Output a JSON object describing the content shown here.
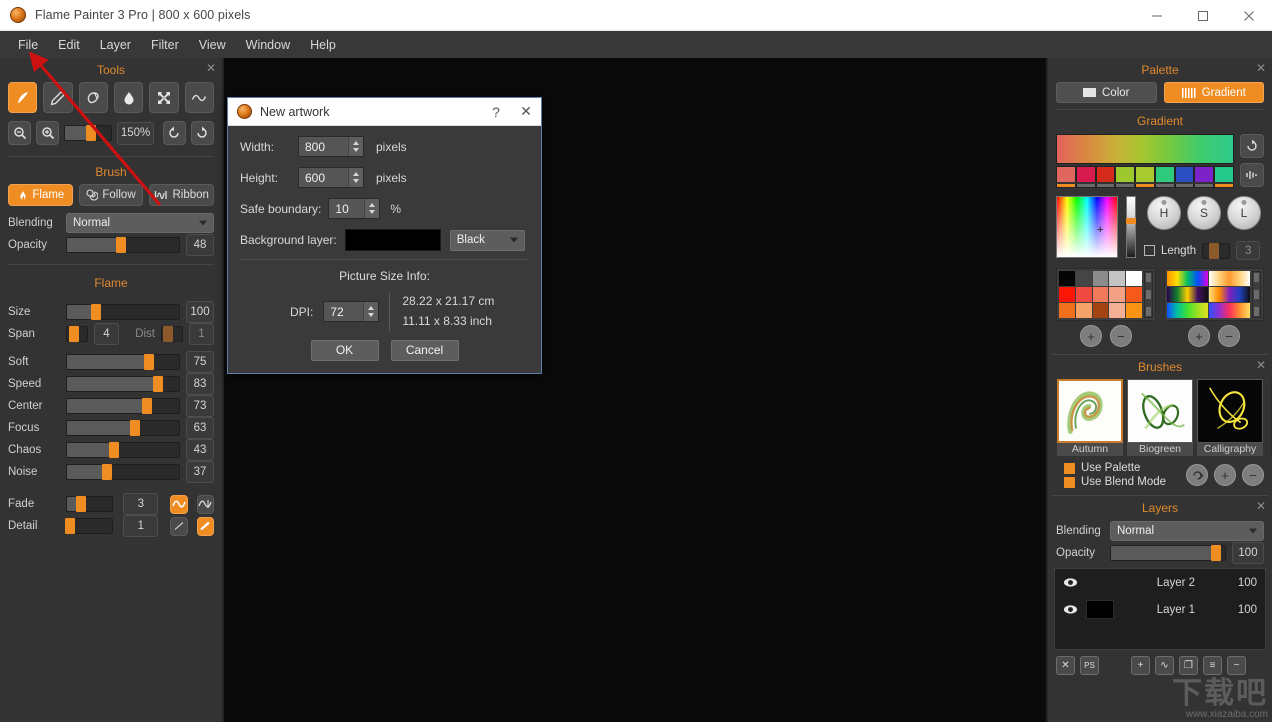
{
  "window": {
    "title": "Flame Painter 3 Pro | 800 x 600 pixels",
    "minimize": "—",
    "maximize": "□",
    "close": "✕"
  },
  "menubar": {
    "items": [
      "File",
      "Edit",
      "Layer",
      "Filter",
      "View",
      "Window",
      "Help"
    ]
  },
  "tools_panel": {
    "title": "Tools",
    "close": "✕",
    "tools": [
      {
        "name": "flame-brush-tool",
        "icon": "feather-icon",
        "active": true
      },
      {
        "name": "pencil-tool",
        "icon": "pencil-icon",
        "active": false
      },
      {
        "name": "eraser-tool",
        "icon": "eraser-icon",
        "active": false
      },
      {
        "name": "smudge-tool",
        "icon": "droplet-icon",
        "active": false
      },
      {
        "name": "transform-tool",
        "icon": "move-arrows-icon",
        "active": false
      },
      {
        "name": "curve-tool",
        "icon": "wave-icon",
        "active": false
      }
    ],
    "zoom_out": "zoom-out-icon",
    "zoom_in": "zoom-in-icon",
    "zoom_value": "150%",
    "zoom_slider_percent": 57,
    "rotate_left": "rotate-ccw-icon",
    "rotate_right": "rotate-cw-icon"
  },
  "brush_panel": {
    "title": "Brush",
    "modes": [
      {
        "label": "Flame",
        "icon": "flame-icon",
        "active": true
      },
      {
        "label": "Follow",
        "icon": "spiral-icon",
        "active": false
      },
      {
        "label": "Ribbon",
        "icon": "ribbon-icon",
        "active": false
      }
    ],
    "blending_label": "Blending",
    "blending_value": "Normal",
    "opacity_label": "Opacity",
    "opacity_value": "48",
    "opacity_percent": 48
  },
  "flame_panel": {
    "title": "Flame",
    "size_label": "Size",
    "size_value": "100",
    "size_percent": 26,
    "span_label": "Span",
    "span_value": "4",
    "span_percent": 35,
    "dist_label": "Dist",
    "dist_value": "1",
    "dist_percent": 30,
    "sliders": [
      {
        "label": "Soft",
        "value": "75",
        "percent": 73
      },
      {
        "label": "Speed",
        "value": "83",
        "percent": 81
      },
      {
        "label": "Center",
        "value": "73",
        "percent": 71
      },
      {
        "label": "Focus",
        "value": "63",
        "percent": 61
      },
      {
        "label": "Chaos",
        "value": "43",
        "percent": 42
      },
      {
        "label": "Noise",
        "value": "37",
        "percent": 36
      }
    ],
    "fade_label": "Fade",
    "fade_value": "3",
    "fade_percent": 30,
    "detail_label": "Detail",
    "detail_value": "1",
    "detail_percent": 6,
    "toggle_a": "wave-filled-icon",
    "toggle_b": "wave-outline-icon",
    "toggle_c": "line-thin-icon",
    "toggle_d": "line-thick-icon"
  },
  "palette_panel": {
    "title": "Palette",
    "close": "✕",
    "mode_color": "Color",
    "mode_gradient": "Gradient",
    "active_mode": "Gradient",
    "gradient_title": "Gradient",
    "gradient_stops": [
      "#e2635e",
      "#d98a3e",
      "#c9b03a",
      "#a8c62f",
      "#74c93e",
      "#3ecb6e",
      "#2ecb8c"
    ],
    "swatch_row": [
      "#e0675f",
      "#d81b4e",
      "#d42b1d",
      "#9dc82e",
      "#a8c92f",
      "#2ec97c",
      "#2c4fc4",
      "#7b23c9",
      "#24c88a"
    ],
    "swatch_underline": [
      "#ef8c22",
      "#6a6a6a",
      "#6a6a6a",
      "#6a6a6a",
      "#ef8c22",
      "#6a6a6a",
      "#6a6a6a",
      "#6a6a6a",
      "#ef8c22"
    ],
    "reset_button": "reset-gradient-icon",
    "equalizer_button": "equalizer-icon",
    "hsl_buttons": [
      "H",
      "S",
      "L"
    ],
    "length_label": "Length",
    "length_value": "3",
    "length_percent": 40,
    "length_checked": false,
    "color_swatches": [
      [
        "#050505",
        "#454545",
        "#8c8c8c",
        "#c4c4c4",
        "#ffffff"
      ],
      [
        "#fb1505",
        "#f04b42",
        "#f07a5a",
        "#f2a186",
        "#f6591c"
      ],
      [
        "#f1701d",
        "#f5a368",
        "#a14412",
        "#f3b095",
        "#fb9412"
      ]
    ],
    "add_color": "+",
    "remove_color": "−",
    "add_gradient": "+",
    "remove_gradient": "−"
  },
  "brushes_panel": {
    "title": "Brushes",
    "close": "✕",
    "brushes": [
      {
        "name": "Autumn",
        "selected": true
      },
      {
        "name": "Biogreen",
        "selected": false
      },
      {
        "name": "Calligraphy",
        "selected": false
      }
    ],
    "use_palette_label": "Use Palette",
    "use_palette_checked": true,
    "use_blend_label": "Use Blend Mode",
    "use_blend_checked": true,
    "load_button": "load-brush-icon",
    "add_button": "+",
    "remove_button": "−"
  },
  "layers_panel": {
    "title": "Layers",
    "close": "✕",
    "blending_label": "Blending",
    "blending_value": "Normal",
    "opacity_label": "Opacity",
    "opacity_value": "100",
    "opacity_percent": 92,
    "layers": [
      {
        "name": "Layer 2",
        "opacity": "100",
        "visible": true,
        "has_thumb": false
      },
      {
        "name": "Layer 1",
        "opacity": "100",
        "visible": true,
        "has_thumb": true
      }
    ],
    "buttons": [
      {
        "name": "clear-layer-button",
        "glyph": "✕"
      },
      {
        "name": "photoshop-export-button",
        "glyph": "PS"
      },
      {
        "name": "add-layer-button",
        "glyph": "+"
      },
      {
        "name": "effects-layer-button",
        "glyph": "∿"
      },
      {
        "name": "duplicate-layer-button",
        "glyph": "❐"
      },
      {
        "name": "merge-layer-button",
        "glyph": "≡"
      },
      {
        "name": "delete-layer-button",
        "glyph": "−"
      }
    ]
  },
  "dialog": {
    "title": "New artwork",
    "help": "?",
    "close": "✕",
    "width_label": "Width:",
    "width_value": "800",
    "width_unit": "pixels",
    "height_label": "Height:",
    "height_value": "600",
    "height_unit": "pixels",
    "safe_label": "Safe boundary:",
    "safe_value": "10",
    "safe_unit": "%",
    "bg_label": "Background layer:",
    "bg_color": "#000000",
    "bg_select": "Black",
    "info_title": "Picture Size Info:",
    "dpi_label": "DPI:",
    "dpi_value": "72",
    "size_cm": "28.22 x 21.17 cm",
    "size_inch": "11.11 x 8.33 inch",
    "ok": "OK",
    "cancel": "Cancel"
  },
  "annotation": {
    "arrow_color": "#cc1111"
  },
  "watermark": {
    "big": "下载吧",
    "small": "www.xiazaiba.com"
  }
}
